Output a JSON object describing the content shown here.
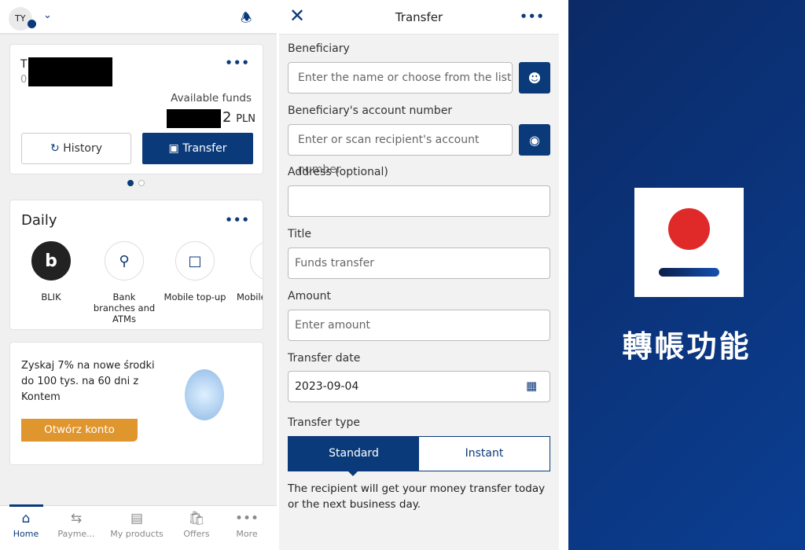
{
  "home": {
    "avatar_initials": "TY",
    "account_name_prefix": "T",
    "account_number_prefix": "0",
    "available_label": "Available funds",
    "balance_suffix": "2",
    "currency": "PLN",
    "history_label": "History",
    "transfer_label": "Transfer",
    "daily_title": "Daily",
    "quick_actions": [
      {
        "label": "BLIK",
        "icon": "blik-logo"
      },
      {
        "label": "Bank branches and ATMs",
        "icon": "map-pin-icon"
      },
      {
        "label": "Mobile top-up",
        "icon": "phone-topup-icon"
      },
      {
        "label": "Mobile",
        "icon": "mobile-icon"
      }
    ],
    "promo_text": "Zyskaj 7% na nowe środki do 100 tys. na 60 dni z Kontem",
    "promo_button": "Otwórz konto",
    "nav": [
      {
        "label": "Home",
        "icon": "home-icon",
        "active": true
      },
      {
        "label": "Payme...",
        "icon": "transfer-arrows-icon"
      },
      {
        "label": "My products",
        "icon": "wallet-icon"
      },
      {
        "label": "Offers",
        "icon": "bag-icon"
      },
      {
        "label": "More",
        "icon": "more-icon"
      }
    ]
  },
  "transfer": {
    "title": "Transfer",
    "beneficiary_label": "Beneficiary",
    "beneficiary_placeholder": "Enter the name or choose from the list",
    "account_label": "Beneficiary's account number",
    "account_placeholder": "Enter or scan recipient's account number",
    "address_label": "Address (optional)",
    "address_value": "",
    "title_label": "Title",
    "title_value": "Funds transfer",
    "amount_label": "Amount",
    "amount_placeholder": "Enter amount",
    "date_label": "Transfer date",
    "date_value": "2023-09-04",
    "type_label": "Transfer type",
    "type_options": [
      "Standard",
      "Instant"
    ],
    "type_selected": "Standard",
    "note": "The recipient will get your money transfer today or the next business day."
  },
  "banner": {
    "caption": "轉帳功能"
  },
  "colors": {
    "navy": "#0a3a7a",
    "orange": "#e0962e",
    "red": "#e02a2a"
  }
}
